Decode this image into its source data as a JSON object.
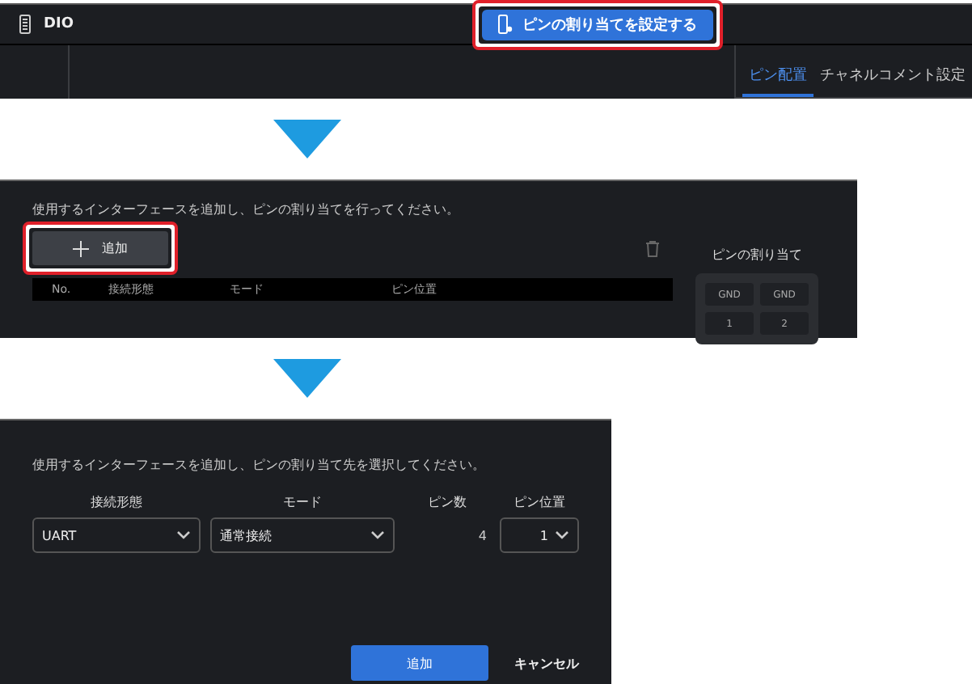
{
  "step1": {
    "app_title": "DIO",
    "assign_button": "ピンの割り当てを設定する",
    "highlighted": true,
    "tabs": [
      {
        "label": "ピン配置",
        "selected": true
      },
      {
        "label": "チャネルコメント設定",
        "selected": false
      }
    ]
  },
  "step2": {
    "instruction": "使用するインターフェースを追加し、ピンの割り当てを行ってください。",
    "add_button": "追加",
    "highlighted": true,
    "columns": [
      "No.",
      "接続形態",
      "モード",
      "ピン位置"
    ],
    "pin_panel": {
      "title": "ピンの割り当て",
      "pins": [
        "GND",
        "GND",
        "1",
        "2"
      ]
    }
  },
  "dialog": {
    "instruction": "使用するインターフェースを追加し、ピンの割り当て先を選択してください。",
    "fields": [
      {
        "label": "接続形態",
        "kind": "select",
        "value": "UART"
      },
      {
        "label": "モード",
        "kind": "select",
        "value": "通常接続"
      },
      {
        "label": "ピン数",
        "kind": "text",
        "value": "4"
      },
      {
        "label": "ピン位置",
        "kind": "select",
        "value": "1"
      }
    ],
    "buttons": [
      {
        "label": "追加",
        "kind": "primary"
      },
      {
        "label": "キャンセル",
        "kind": "secondary"
      }
    ]
  }
}
